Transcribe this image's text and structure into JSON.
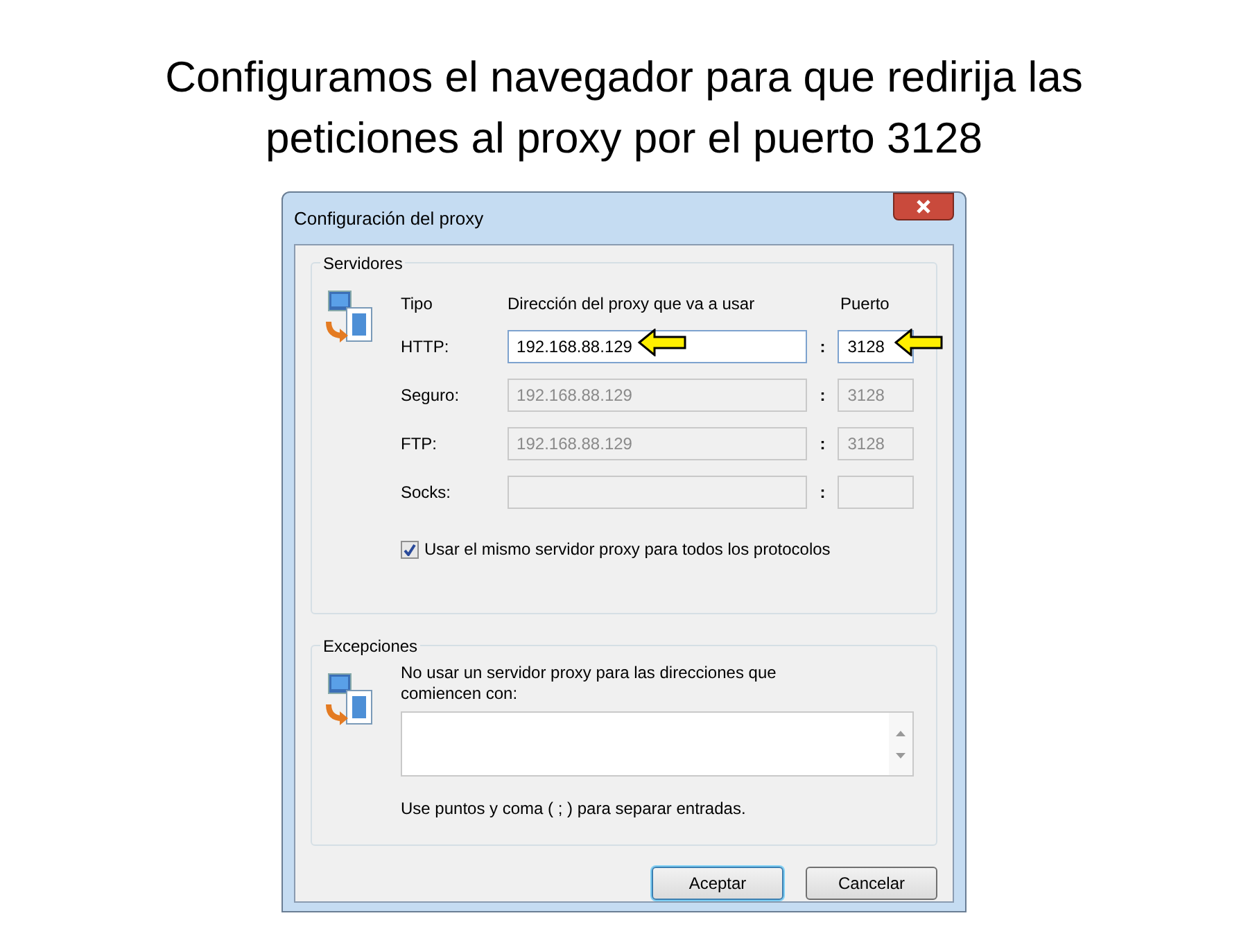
{
  "slide": {
    "title": "Configuramos el navegador para que redirija las peticiones al proxy por el puerto 3128"
  },
  "dialog": {
    "title": "Configuración del proxy",
    "servers": {
      "legend": "Servidores",
      "headers": [
        "Tipo",
        "Dirección del proxy que va a usar",
        "Puerto"
      ],
      "rows": [
        {
          "label": "HTTP:",
          "address": "192.168.88.129",
          "separator": ":",
          "port": "3128",
          "disabled": false,
          "pointed": true
        },
        {
          "label": "Seguro:",
          "address": "192.168.88.129",
          "separator": ":",
          "port": "3128",
          "disabled": true,
          "pointed": false
        },
        {
          "label": "FTP:",
          "address": "192.168.88.129",
          "separator": ":",
          "port": "3128",
          "disabled": true,
          "pointed": false
        },
        {
          "label": "Socks:",
          "separator": ":",
          "disabled": true,
          "pointed": false
        }
      ],
      "same_for_all": {
        "label": "Usar el mismo servidor proxy para todos los protocolos",
        "checked": true
      }
    },
    "exceptions": {
      "legend": "Excepciones",
      "description": "No usar un servidor proxy para las direcciones que comiencen con:",
      "note": "Use puntos y coma ( ; ) para separar entradas."
    },
    "buttons": [
      {
        "label": "Aceptar",
        "default": true
      },
      {
        "label": "Cancelar",
        "default": false
      }
    ]
  }
}
